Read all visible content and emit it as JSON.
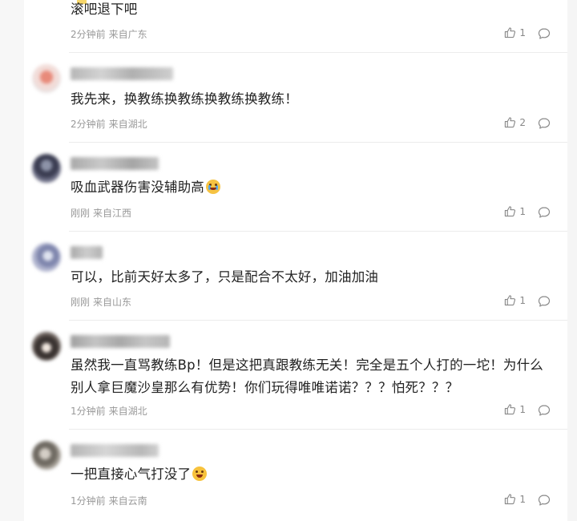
{
  "comments": [
    {
      "text": "滚吧退下吧",
      "time": "2分钟前",
      "location": "来自广东",
      "likes": "1"
    },
    {
      "text": "我先来，换教练换教练换教练换教练！",
      "time": "2分钟前",
      "location": "来自湖北",
      "likes": "2"
    },
    {
      "text": "吸血武器伤害没辅助高",
      "time": "刚刚",
      "location": "来自江西",
      "likes": "1"
    },
    {
      "text": "可以，比前天好太多了，只是配合不太好，加油加油",
      "time": "刚刚",
      "location": "来自山东",
      "likes": "1"
    },
    {
      "text": "虽然我一直骂教练Bp！但是这把真跟教练无关！完全是五个人打的一坨！为什么别人拿巨魔沙皇那么有优势！你们玩得唯唯诺诺？？？怕死？？？",
      "time": "1分钟前",
      "location": "来自湖北",
      "likes": "1"
    },
    {
      "text": "一把直接心气打没了",
      "time": "1分钟前",
      "location": "来自云南",
      "likes": "1"
    }
  ],
  "icons": {
    "like": "thumbs-up-icon",
    "reply": "comment-bubble-icon",
    "emoji_cry": "crying-face-icon",
    "emoji_laugh": "laughing-face-icon"
  }
}
